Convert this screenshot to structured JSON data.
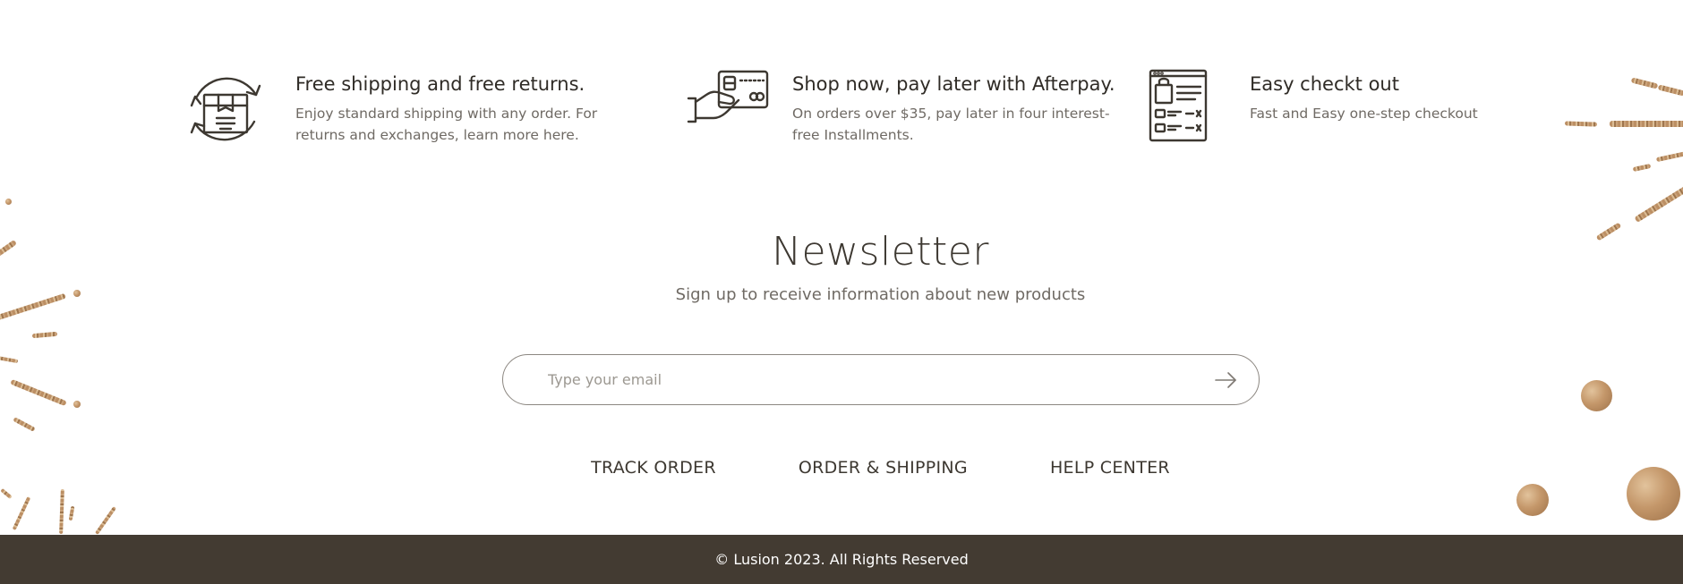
{
  "features": [
    {
      "icon": "box-returns-icon",
      "title": "Free shipping and free returns.",
      "desc_line1": "Enjoy standard shipping with any order. For",
      "desc_line2": "returns and exchanges, learn more here."
    },
    {
      "icon": "credit-card-hand-icon",
      "title": "Shop now, pay later with Afterpay.",
      "desc_line1": "On orders over $35, pay later in four interest-",
      "desc_line2": "free Installments."
    },
    {
      "icon": "checkout-page-icon",
      "title": "Easy checkt out",
      "desc_line1": "Fast and Easy one-step checkout",
      "desc_line2": ""
    }
  ],
  "newsletter": {
    "title": "Newsletter",
    "subtitle": "Sign up to receive information about new products",
    "email_placeholder": "Type your email",
    "email_value": "",
    "submit_icon": "arrow-right-icon"
  },
  "links": {
    "track_order": "TRACK ORDER",
    "order_shipping": "ORDER & SHIPPING",
    "help_center": "HELP CENTER"
  },
  "footer": {
    "copyright": "© Lusion 2023. All Rights Reserved"
  },
  "colors": {
    "text_dark": "#3d3831",
    "text_muted": "#6f6a64",
    "footer_bg": "#433b32",
    "glitter_gold": "#b8895c"
  }
}
